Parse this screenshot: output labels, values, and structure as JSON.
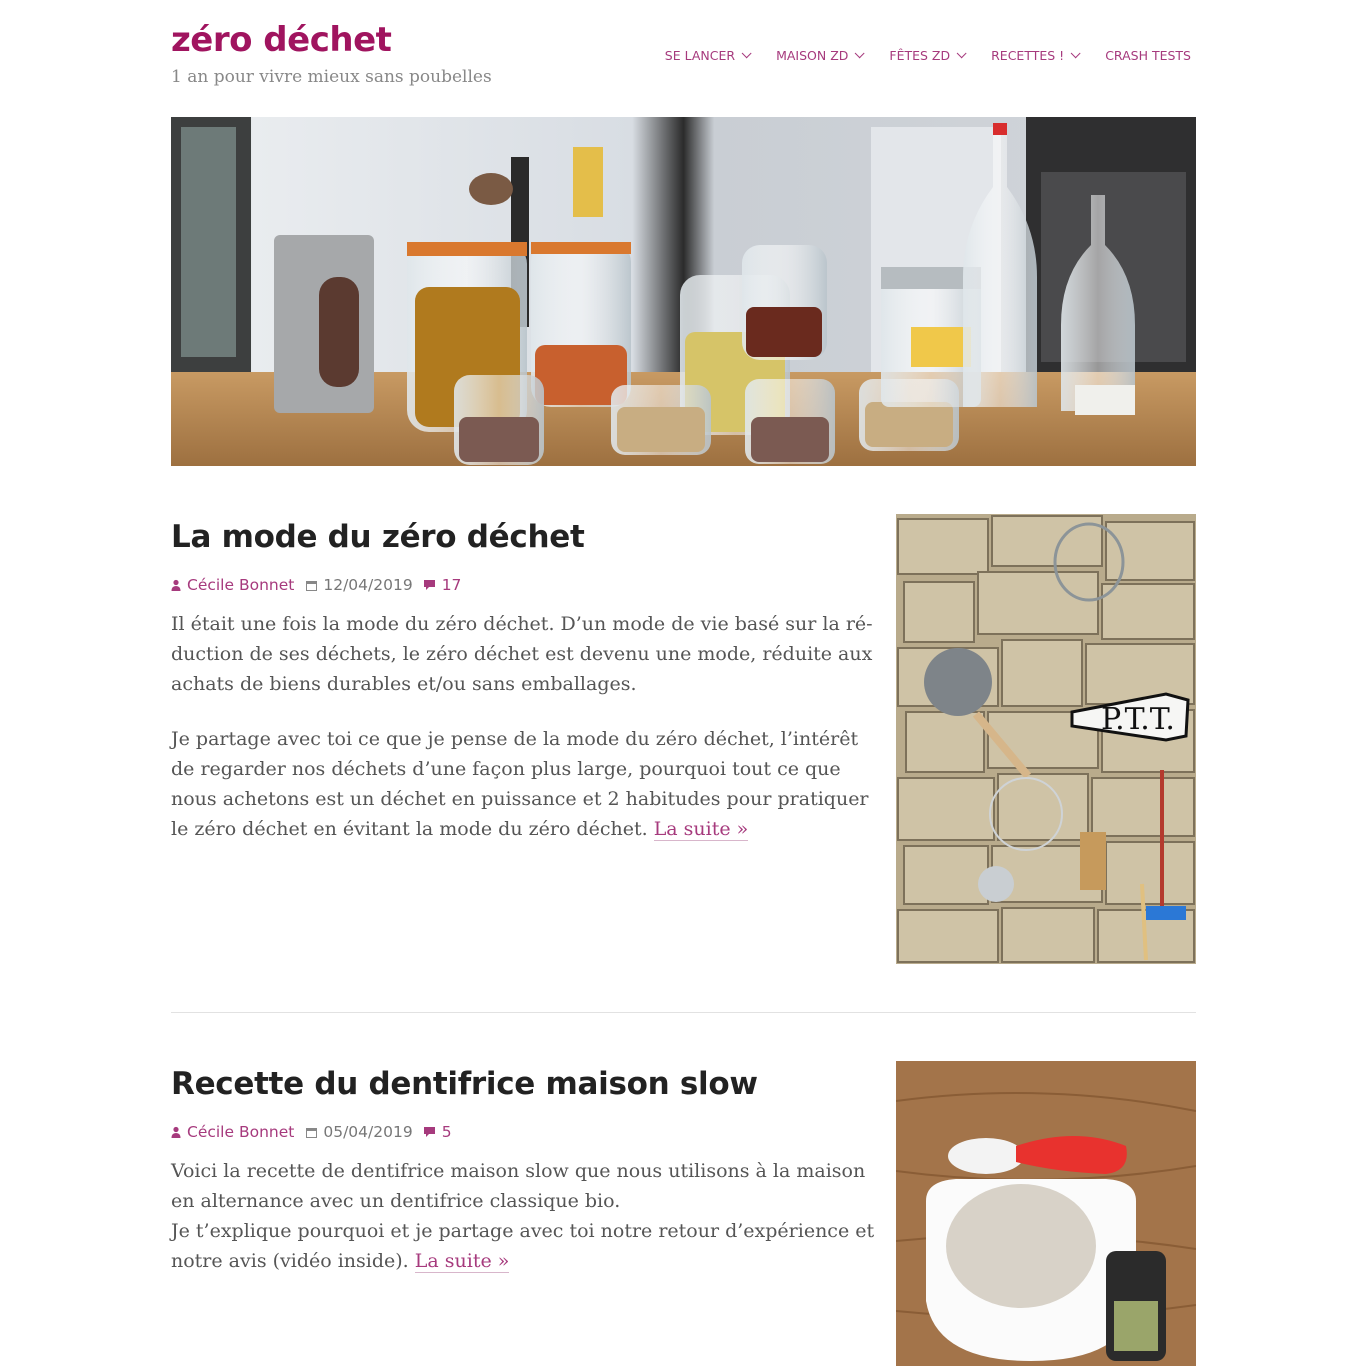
{
  "site": {
    "title": "zéro déchet",
    "description": "1 an pour vivre mieux sans poubelles"
  },
  "nav": {
    "items": [
      {
        "label": "SE LANCER",
        "has_dropdown": true
      },
      {
        "label": "MAISON ZD",
        "has_dropdown": true
      },
      {
        "label": "FÊTES ZD",
        "has_dropdown": true
      },
      {
        "label": "RECETTES !",
        "has_dropdown": true
      },
      {
        "label": "CRASH TESTS",
        "has_dropdown": false
      }
    ]
  },
  "colors": {
    "accent": "#a0145f",
    "link": "#a63a7d",
    "text": "#555555",
    "heading": "#222222"
  },
  "posts": [
    {
      "title": "La mode du zéro déchet",
      "author": "Cécile Bonnet",
      "date": "12/04/2019",
      "comments": "17",
      "paragraph_1": "Il était une fois la mode du zéro déchet. D’un mode de vie basé sur la ré-duction de ses déchets, le zéro déchet est devenu une mode, réduite aux achats de biens durables et/ou sans emballages.",
      "paragraph_2": "Je partage avec toi ce que je pense de la mode du zéro déchet, l’intérêt de regarder nos déchets d’une façon plus large, pourquoi tout ce que nous achetons est un déchet en puissance et 2 habitudes pour pratiquer le zéro déchet en évitant la mode du zéro déchet.",
      "more": "La suite »",
      "thumbnail": "stone-wall-utensils-photo",
      "sign_text": "P.T.T."
    },
    {
      "title": "Recette du dentifrice maison slow",
      "author": "Cécile Bonnet",
      "date": "05/04/2019",
      "comments": "5",
      "paragraph_1": "Voici la recette de dentifrice maison slow que nous utilisons à la maison en alternance avec un dentifrice classique bio.",
      "paragraph_2": "Je t’explique pourquoi et je partage avec toi notre retour d’expérience et notre avis (vidéo inside).",
      "more": "La suite »",
      "thumbnail": "toothpaste-powder-bowl-photo"
    }
  ],
  "hero": {
    "image": "kitchen-jars-photo"
  }
}
